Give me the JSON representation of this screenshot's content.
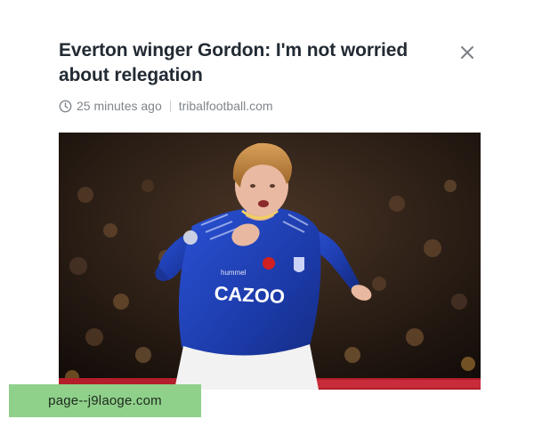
{
  "article": {
    "title": "Everton winger Gordon: I'm not worried about relegation",
    "time_ago": "25 minutes ago",
    "source": "tribalfootball.com",
    "photo_icon": "photo-football-player"
  },
  "controls": {
    "close_icon": "close-icon",
    "clock_icon": "clock-icon"
  },
  "overlay": {
    "watermark_text": "page--j9laoge.com"
  },
  "colors": {
    "title": "#222a33",
    "meta": "#80868b",
    "kit_blue": "#1e3fb8",
    "watermark_bg": "#8fd08a"
  }
}
